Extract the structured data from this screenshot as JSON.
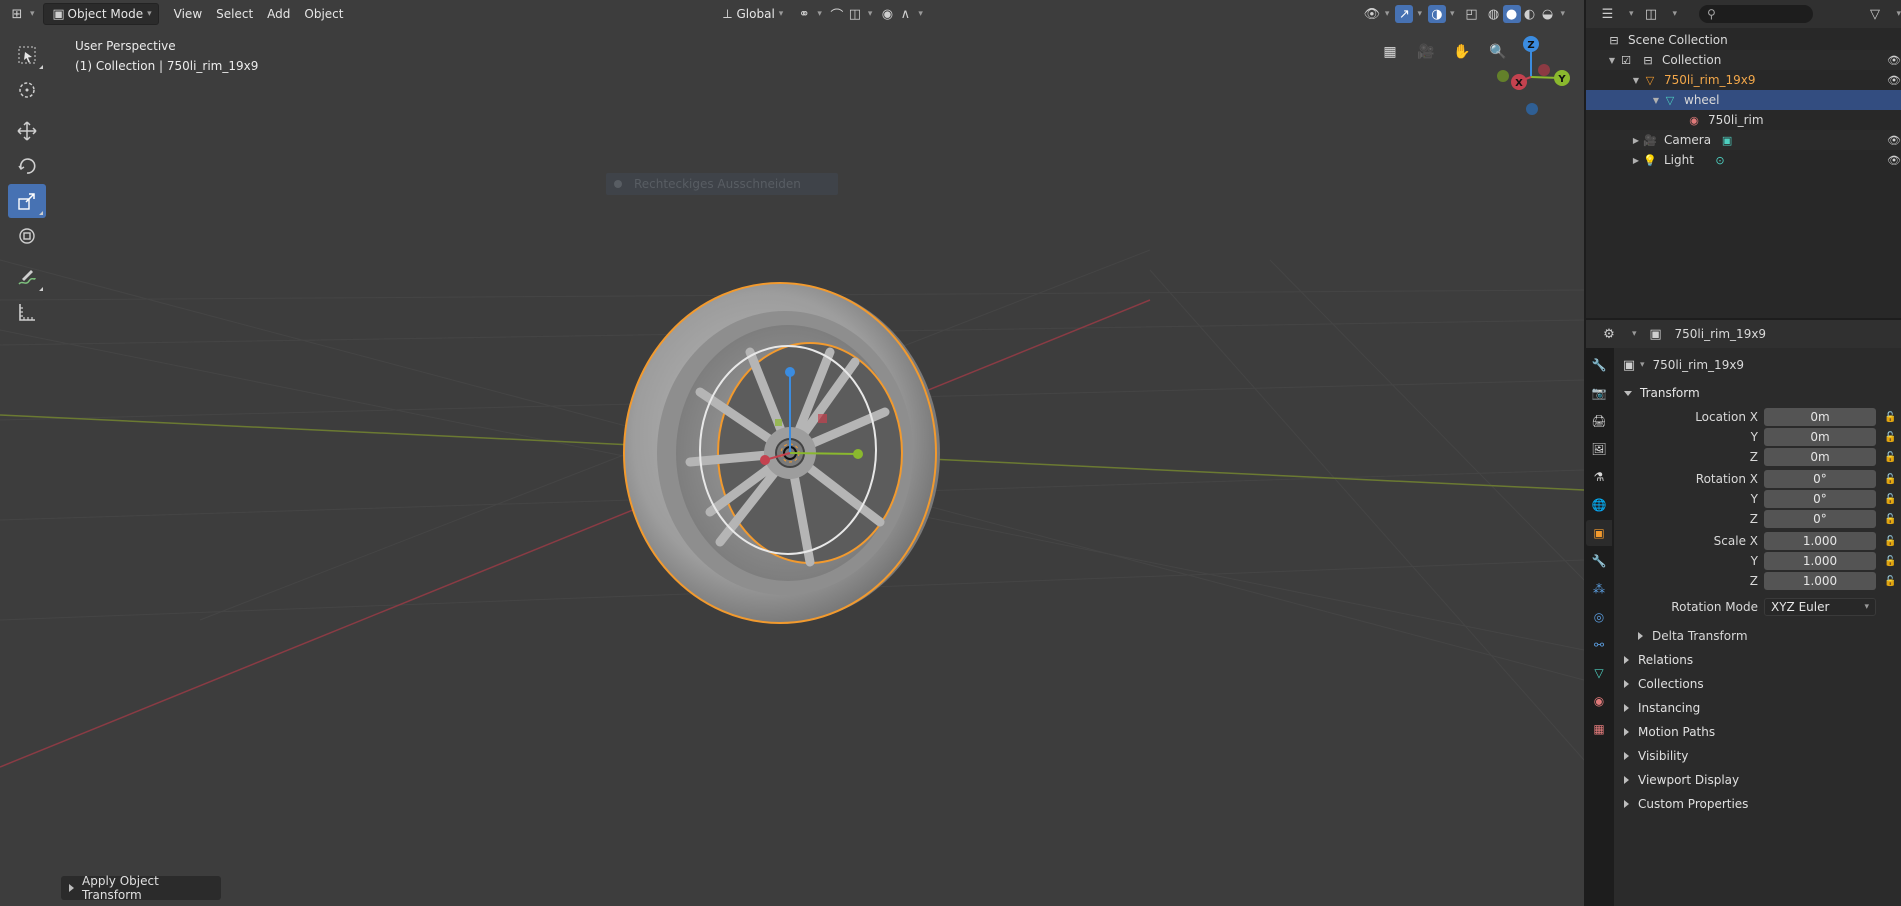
{
  "viewport": {
    "header": {
      "mode": "Object Mode",
      "menus": [
        "View",
        "Select",
        "Add",
        "Object"
      ],
      "transform_orientation": "Global"
    },
    "info": {
      "perspective": "User Perspective",
      "collection": "(1) Collection | 750li_rim_19x9"
    },
    "ghost_tooltip": "Rechteckiges Ausschneiden",
    "gizmo": {
      "x": "X",
      "y": "Y",
      "z": "Z"
    },
    "last_operator": "Apply Object Transform"
  },
  "outliner": {
    "items": [
      {
        "label": "Scene Collection"
      },
      {
        "label": "Collection"
      },
      {
        "label": "750li_rim_19x9"
      },
      {
        "label": "wheel"
      },
      {
        "label": "750li_rim"
      },
      {
        "label": "Camera"
      },
      {
        "label": "Light"
      }
    ]
  },
  "properties": {
    "header_object": "750li_rim_19x9",
    "object_name": "750li_rim_19x9",
    "transform": {
      "title": "Transform",
      "location": {
        "label": "Location X",
        "x": "0m",
        "y": "0m",
        "z": "0m"
      },
      "rotation": {
        "label": "Rotation X",
        "x": "0°",
        "y": "0°",
        "z": "0°"
      },
      "scale": {
        "label": "Scale X",
        "x": "1.000",
        "y": "1.000",
        "z": "1.000"
      },
      "axis_y": "Y",
      "axis_z": "Z",
      "rotation_mode_label": "Rotation Mode",
      "rotation_mode": "XYZ Euler",
      "delta": "Delta Transform"
    },
    "panels": [
      "Relations",
      "Collections",
      "Instancing",
      "Motion Paths",
      "Visibility",
      "Viewport Display",
      "Custom Properties"
    ]
  },
  "colors": {
    "viewport_bg": "#3d3d3d",
    "selected_outline": "#f29a2e",
    "active_blue": "#4772b3",
    "x_axis": "#c4424f",
    "y_axis": "#8ab82e",
    "z_axis": "#3b8ce0"
  }
}
